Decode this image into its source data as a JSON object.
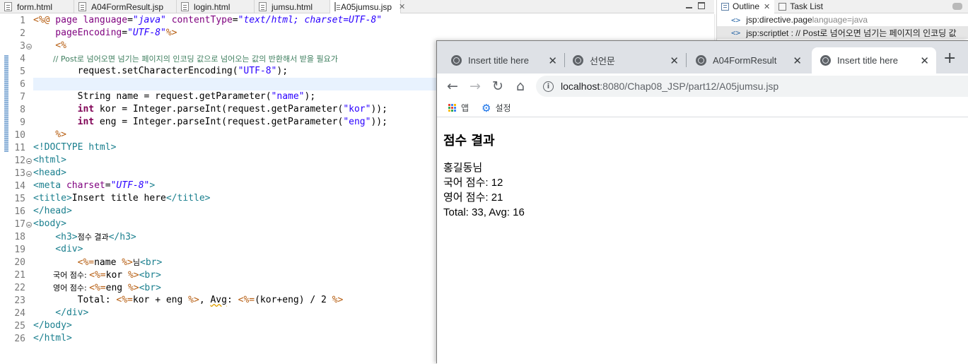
{
  "editor": {
    "tabs": [
      "form.html",
      "A04FormResult.jsp",
      "login.html",
      "jumsu.html",
      "A05jumsu.jsp"
    ],
    "active_tab_close": "✕",
    "line_numbers": [
      "1",
      "2",
      "3",
      "4",
      "5",
      "6",
      "7",
      "8",
      "9",
      "10",
      "11",
      "12",
      "13",
      "14",
      "15",
      "16",
      "17",
      "18",
      "19",
      "20",
      "21",
      "22",
      "23",
      "24",
      "25",
      "26"
    ],
    "code": {
      "l1_open": "<%@",
      "l1_page": " page ",
      "l1_lang_attr": "language",
      "l1_eq1": "=",
      "l1_lang_val": "\"java\"",
      "l1_ct_attr": " contentType",
      "l1_eq2": "=",
      "l1_ct_val": "\"text/html; charset=UTF-8\"",
      "l2_pe_attr": "    pageEncoding",
      "l2_eq": "=",
      "l2_pe_val": "\"UTF-8\"",
      "l2_close": "%>",
      "l3": "    <%",
      "l4": "        // Post로 넘어오면 넘기는 페이지의 인코딩 값으로 넘어오는 값의 반환해서 받을 필요가",
      "l5_a": "        request.setCharacterEncoding(",
      "l5_b": "\"UTF-8\"",
      "l5_c": ");",
      "l7_a": "        String name = request.getParameter(",
      "l7_b": "\"name\"",
      "l7_c": ");",
      "l8_kw": "int",
      "l8_a": " kor = Integer.parseInt(request.getParameter(",
      "l8_b": "\"kor\"",
      "l8_c": "));",
      "l9_kw": "int",
      "l9_a": " eng = Integer.parseInt(request.getParameter(",
      "l9_b": "\"eng\"",
      "l9_c": "));",
      "l10": "    %>",
      "l11": "<!DOCTYPE html>",
      "l12": "<html>",
      "l13": "<head>",
      "l14_a": "<meta ",
      "l14_attr": "charset",
      "l14_eq": "=",
      "l14_val": "\"UTF-8\"",
      "l14_c": ">",
      "l15_a": "<title>",
      "l15_b": "Insert title here",
      "l15_c": "</title>",
      "l16": "</head>",
      "l17": "<body>",
      "l18_a": "    <h3>",
      "l18_b": "점수 결과",
      "l18_c": "</h3>",
      "l19": "    <div>",
      "l20_a": "        <%=",
      "l20_b": "name ",
      "l20_c": "%>",
      "l20_d": "님",
      "l20_e": "<br>",
      "l21_a": "        국어 점수: ",
      "l21_b": "<%=",
      "l21_c": "kor ",
      "l21_d": "%>",
      "l21_e": "<br>",
      "l22_a": "        영어 점수: ",
      "l22_b": "<%=",
      "l22_c": "eng ",
      "l22_d": "%>",
      "l22_e": "<br>",
      "l23_a": "        Total: ",
      "l23_b": "<%=",
      "l23_c": "kor + eng ",
      "l23_d": "%>",
      "l23_e": ", ",
      "l23_f": "Avg",
      "l23_g": ": ",
      "l23_h": "<%=",
      "l23_i": "(kor+eng) / 2 ",
      "l23_j": "%>",
      "l24": "    </div>",
      "l25": "</body>",
      "l26": "</html>"
    }
  },
  "outline": {
    "tab_outline": "Outline",
    "tab_close": "✕",
    "tab_tasks": "Task List",
    "items": [
      {
        "marker": "<>",
        "label": "jsp:directive.page",
        "detail": " language=java"
      },
      {
        "marker": "<>",
        "label": "jsp:scriptlet : // Post로 넘어오면 넘기는 페이지의 인코딩 값",
        "detail": ""
      }
    ]
  },
  "browser": {
    "tabs": [
      {
        "title": "Insert title here",
        "close": "✕"
      },
      {
        "title": "선언문",
        "close": "✕"
      },
      {
        "title": "A04FormResult",
        "close": "✕"
      },
      {
        "title": "Insert title here",
        "close": "✕"
      }
    ],
    "new_tab": "+",
    "back": "←",
    "forward": "→",
    "reload": "↻",
    "home": "⌂",
    "info": "i",
    "url_host": "localhost",
    "url_path": ":8080/Chap08_JSP/part12/A05jumsu.jsp",
    "bookmarks": {
      "apps": "앱",
      "settings_icon": "⚙",
      "settings": "설정"
    },
    "apps_colors": [
      "#ea4335",
      "#4285f4",
      "#fbbc05",
      "#34a853",
      "#ea4335",
      "#4285f4",
      "#fbbc05",
      "#34a853",
      "#4285f4"
    ],
    "page": {
      "heading": "점수 결과",
      "lines": [
        "홍길동님",
        "국어 점수: 12",
        "영어 점수: 21",
        "Total: 33, Avg: 16"
      ]
    }
  }
}
